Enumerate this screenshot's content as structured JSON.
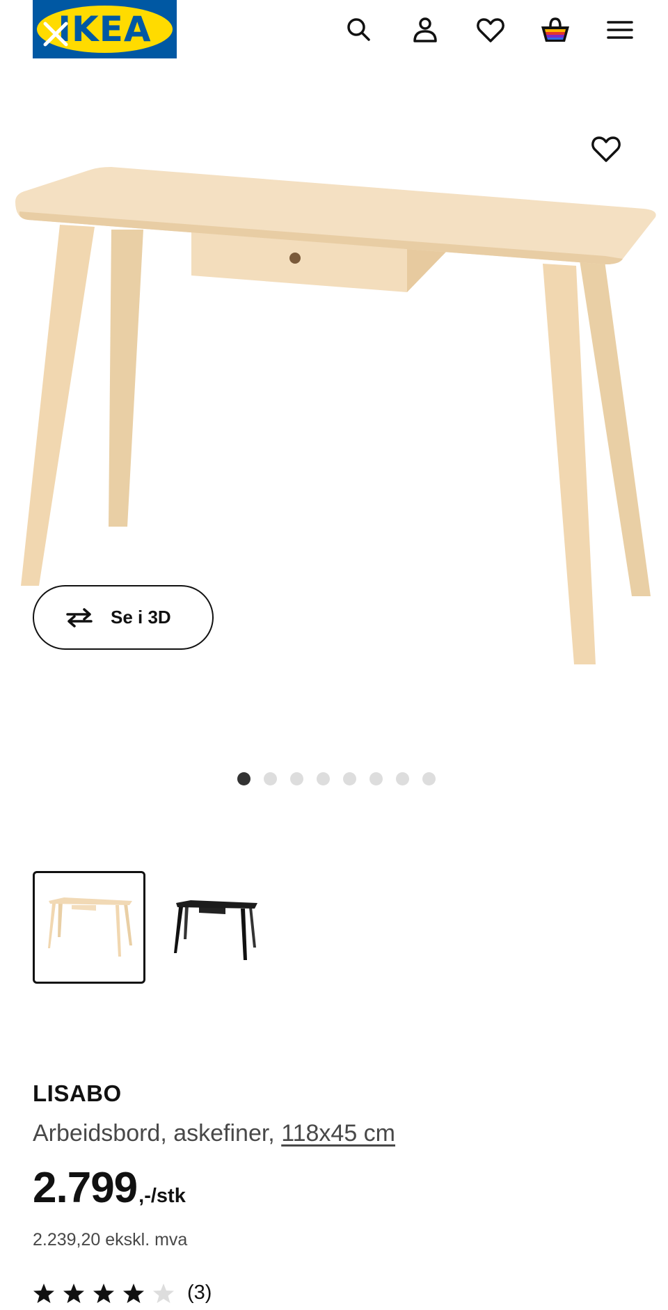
{
  "header": {
    "logo_text": "IKEA",
    "icons": [
      "close-icon",
      "search-icon",
      "user-icon",
      "heart-icon",
      "shopping-bag-icon",
      "menu-icon"
    ]
  },
  "hero": {
    "favorite_icon": "heart-outline-icon",
    "view_3d_label": "Se i 3D",
    "view_3d_icon": "rotate-3d-icon",
    "image_count": 8,
    "active_image": 1
  },
  "variants": [
    {
      "finish": "light-wood",
      "selected": true
    },
    {
      "finish": "black",
      "selected": false
    }
  ],
  "product": {
    "name": "LISABO",
    "description": "Arbeidsbord, askefiner, ",
    "dimensions": "118x45 cm",
    "price": "2.799",
    "price_suffix": ",-/stk",
    "price_ex_vat": "2.239,20 ekskl. mva",
    "rating": 4.5,
    "rating_max": 5,
    "review_count": "(3)"
  },
  "colors": {
    "ikea_blue": "#0058A3",
    "ikea_yellow": "#FFDB00",
    "text_primary": "#111111",
    "text_secondary": "#484848",
    "wood": "#F1D9B5"
  }
}
